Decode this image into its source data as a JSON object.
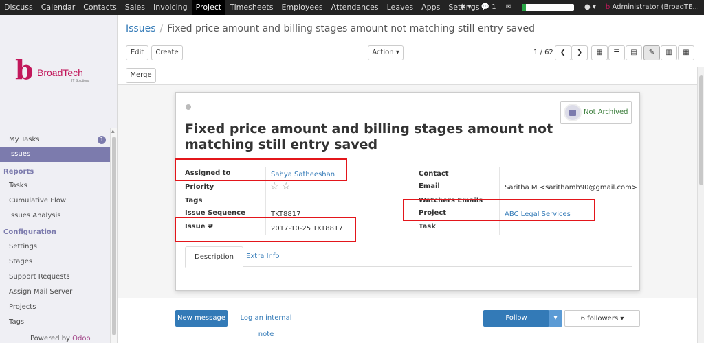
{
  "topbar": {
    "menu": [
      "Discuss",
      "Calendar",
      "Contacts",
      "Sales",
      "Invoicing",
      "Project",
      "Timesheets",
      "Employees",
      "Attendances",
      "Leaves",
      "Apps",
      "Settings"
    ],
    "active_index": 5,
    "bug_icon": "bug-icon",
    "chat_count": "1",
    "help_icon": "question-icon",
    "user": "Administrator (BroadTE..."
  },
  "sidebar": {
    "logo": {
      "mark": "b",
      "name": "BroadTech",
      "tag": "IT Solutions"
    },
    "my_tasks": {
      "label": "My Tasks",
      "badge": "1"
    },
    "issues": "Issues",
    "reports_header": "Reports",
    "reports": [
      "Tasks",
      "Cumulative Flow",
      "Issues Analysis"
    ],
    "config_header": "Configuration",
    "config": [
      "Settings",
      "Stages",
      "Support Requests",
      "Assign Mail Server",
      "Projects",
      "Tags"
    ],
    "powered_by": "Powered by",
    "powered_brand": "Odoo"
  },
  "control_panel": {
    "breadcrumb_root": "Issues",
    "breadcrumb_sep": "/",
    "breadcrumb_current": "Fixed price amount and billing stages amount not matching still entry saved",
    "edit_label": "Edit",
    "create_label": "Create",
    "action_label": "Action ▾",
    "pager": "1 / 62",
    "merge_label": "Merge"
  },
  "form": {
    "archive_label": "Not Archived",
    "title": "Fixed price amount and billing stages amount not matching still entry saved",
    "left_fields": [
      {
        "label": "Assigned to",
        "value": "Sahya Satheeshan"
      },
      {
        "label": "Priority",
        "value": ""
      },
      {
        "label": "Tags",
        "value": ""
      },
      {
        "label": "Issue Sequence",
        "value": "TKT8817"
      },
      {
        "label": "Issue #",
        "value": "2017-10-25 TKT8817"
      }
    ],
    "right_fields": [
      {
        "label": "Contact",
        "value": ""
      },
      {
        "label": "Email",
        "value": "Saritha M <sarithamh90@gmail.com>"
      },
      {
        "label": "Watchers Emails",
        "value": ""
      },
      {
        "label": "Project",
        "value": "ABC Legal Services"
      },
      {
        "label": "Task",
        "value": ""
      }
    ],
    "tabs": [
      "Description",
      "Extra Info"
    ]
  },
  "chatter": {
    "new_message": "New message",
    "log_note": "Log an internal note",
    "follow": "Follow",
    "followers": "6 followers ▾"
  },
  "colors": {
    "brand": "#7c7bad",
    "link": "#337ab7",
    "highlight_box": "#e3161b",
    "follow_button": "#337ab7"
  }
}
